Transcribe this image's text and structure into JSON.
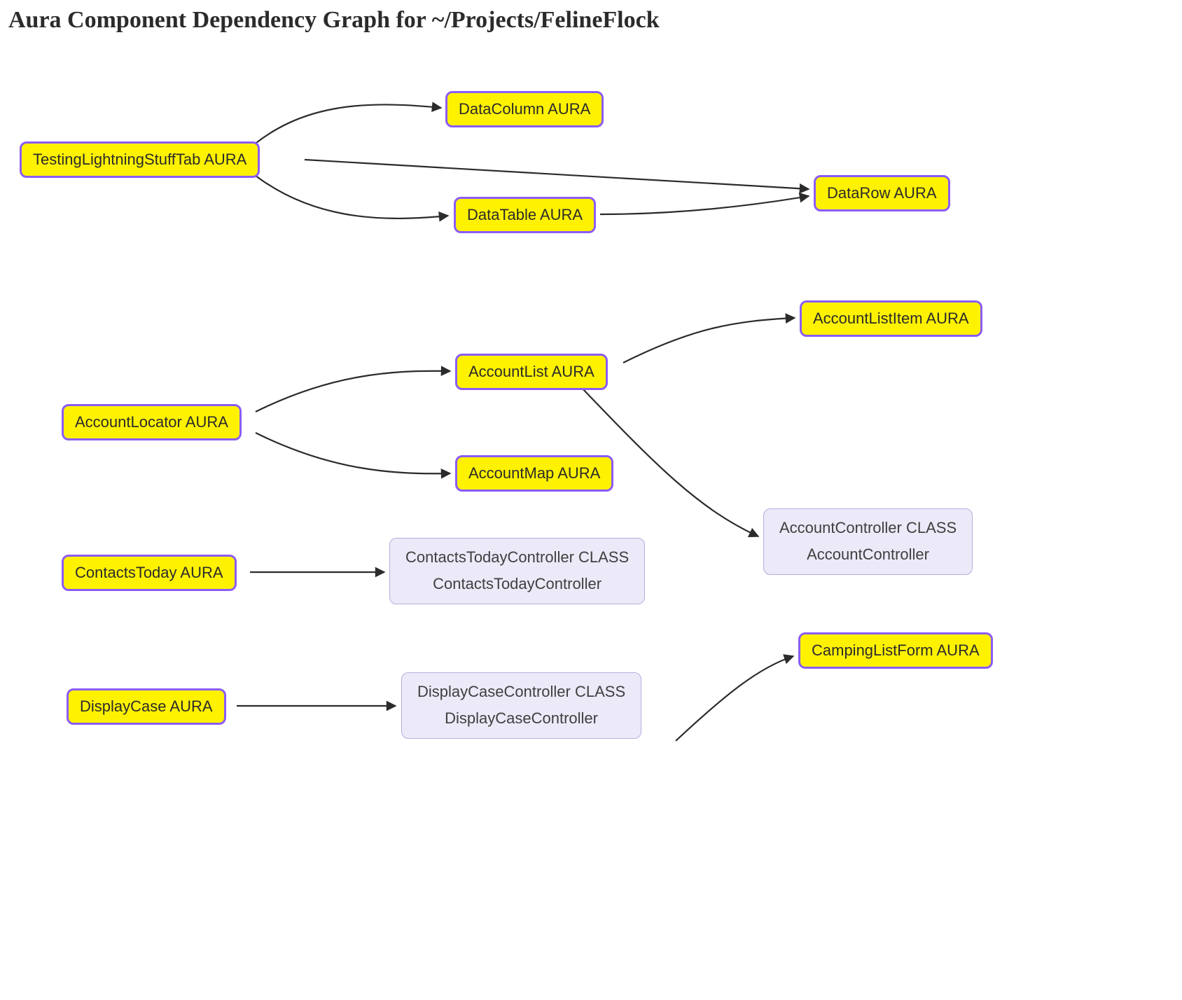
{
  "title": "Aura Component Dependency Graph for ~/Projects/FelineFlock",
  "colors": {
    "aura_fill": "#fff200",
    "aura_border": "#8b5cf6",
    "class_fill": "#ece9f8",
    "class_border": "#b6aee0",
    "edge": "#2b2b2b"
  },
  "nodes": {
    "testingLightningStuffTab": {
      "label": "TestingLightningStuffTab AURA",
      "type": "aura"
    },
    "dataColumn": {
      "label": "DataColumn AURA",
      "type": "aura"
    },
    "dataTable": {
      "label": "DataTable AURA",
      "type": "aura"
    },
    "dataRow": {
      "label": "DataRow AURA",
      "type": "aura"
    },
    "accountLocator": {
      "label": "AccountLocator AURA",
      "type": "aura"
    },
    "accountList": {
      "label": "AccountList AURA",
      "type": "aura"
    },
    "accountMap": {
      "label": "AccountMap AURA",
      "type": "aura"
    },
    "accountListItem": {
      "label": "AccountListItem AURA",
      "type": "aura"
    },
    "accountController": {
      "title": "AccountController CLASS",
      "subtitle": "AccountController",
      "type": "class"
    },
    "contactsToday": {
      "label": "ContactsToday AURA",
      "type": "aura"
    },
    "contactsTodayController": {
      "title": "ContactsTodayController CLASS",
      "subtitle": "ContactsTodayController",
      "type": "class"
    },
    "displayCase": {
      "label": "DisplayCase AURA",
      "type": "aura"
    },
    "displayCaseController": {
      "title": "DisplayCaseController CLASS",
      "subtitle": "DisplayCaseController",
      "type": "class"
    },
    "campingListForm": {
      "label": "CampingListForm AURA",
      "type": "aura"
    }
  },
  "edges": [
    {
      "from": "testingLightningStuffTab",
      "to": "dataColumn"
    },
    {
      "from": "testingLightningStuffTab",
      "to": "dataTable"
    },
    {
      "from": "testingLightningStuffTab",
      "to": "dataRow"
    },
    {
      "from": "dataTable",
      "to": "dataRow"
    },
    {
      "from": "accountLocator",
      "to": "accountList"
    },
    {
      "from": "accountLocator",
      "to": "accountMap"
    },
    {
      "from": "accountList",
      "to": "accountListItem"
    },
    {
      "from": "accountList",
      "to": "accountController"
    },
    {
      "from": "contactsToday",
      "to": "contactsTodayController"
    },
    {
      "from": "displayCase",
      "to": "displayCaseController"
    },
    {
      "from": "_offscreen_bottom",
      "to": "campingListForm"
    }
  ]
}
